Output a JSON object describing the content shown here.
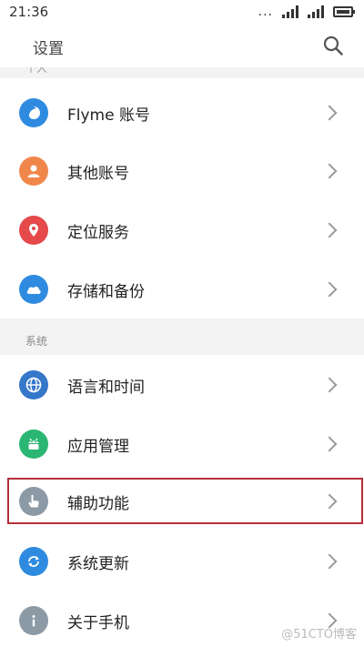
{
  "status_bar": {
    "time": "21:36",
    "dots": "..."
  },
  "app_bar": {
    "title": "设置"
  },
  "partial_header": "个人",
  "section_system": "系统",
  "items": [
    {
      "label": "Flyme 账号",
      "color": "#2f8be0",
      "icon": "flyme-account-icon"
    },
    {
      "label": "其他账号",
      "color": "#f0874a",
      "icon": "person-icon"
    },
    {
      "label": "定位服务",
      "color": "#e5494a",
      "icon": "location-pin-icon"
    },
    {
      "label": "存储和备份",
      "color": "#2f8be0",
      "icon": "cloud-icon"
    },
    {
      "label": "语言和时间",
      "color": "#3577c9",
      "icon": "globe-icon"
    },
    {
      "label": "应用管理",
      "color": "#2bb673",
      "icon": "android-icon"
    },
    {
      "label": "辅助功能",
      "color": "#8c9aa6",
      "icon": "hand-pointer-icon"
    },
    {
      "label": "系统更新",
      "color": "#2f8be0",
      "icon": "refresh-icon"
    },
    {
      "label": "关于手机",
      "color": "#8c9aa6",
      "icon": "info-icon"
    }
  ],
  "watermark": "@51CTO博客"
}
